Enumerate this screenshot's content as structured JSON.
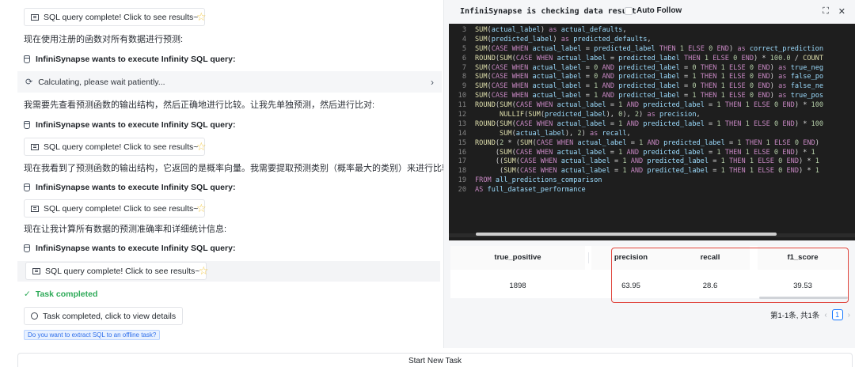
{
  "chat": {
    "chip_label": "SQL query complete! Click to see results~",
    "exec_label": "InfiniSynapse wants to execute Infinity SQL query:",
    "msg1": "现在使用注册的函数对所有数据进行预测:",
    "calculating": "Calculating, please wait patiently...",
    "msg2": "我需要先查看预测函数的输出结构，然后正确地进行比较。让我先单独预测，然后进行比对:",
    "msg3": "现在我看到了预测函数的输出结构，它返回的是概率向量。我需要提取预测类别（概率最大的类别）来进行比较:",
    "msg4": "现在让我计算所有数据的预测准确率和详细统计信息:",
    "task_completed": "Task completed",
    "view_details": "Task completed, click to view details",
    "extract_prompt": "Do you want to extract SQL to an offline task?",
    "new_task": "Start New Task"
  },
  "panel": {
    "title": "InfiniSynapse is checking data result",
    "auto_follow": "Auto Follow",
    "code_lines": [
      {
        "n": "3",
        "html": "<span class='fn'>SUM</span>(<span class='id'>actual_label</span>) <span class='kw'>as</span> <span class='id'>actual_defaults</span>,"
      },
      {
        "n": "4",
        "html": "<span class='fn'>SUM</span>(<span class='id'>predicted_label</span>) <span class='kw'>as</span> <span class='id'>predicted_defaults</span>,"
      },
      {
        "n": "5",
        "html": "<span class='fn'>SUM</span>(<span class='kw'>CASE WHEN</span> <span class='id'>actual_label</span> = <span class='id'>predicted_label</span> <span class='kw'>THEN</span> <span class='num'>1</span> <span class='kw'>ELSE</span> <span class='num'>0</span> <span class='kw'>END</span>) <span class='kw'>as</span> <span class='id'>correct_prediction</span>"
      },
      {
        "n": "6",
        "html": "<span class='fn'>ROUND</span>(<span class='fn'>SUM</span>(<span class='kw'>CASE WHEN</span> <span class='id'>actual_label</span> = <span class='id'>predicted_label</span> <span class='kw'>THEN</span> <span class='num'>1</span> <span class='kw'>ELSE</span> <span class='num'>0</span> <span class='kw'>END</span>) * <span class='num'>100.0</span> / <span class='fn'>COUNT</span>"
      },
      {
        "n": "7",
        "html": "<span class='fn'>SUM</span>(<span class='kw'>CASE WHEN</span> <span class='id'>actual_label</span> = <span class='num'>0</span> <span class='kw'>AND</span> <span class='id'>predicted_label</span> = <span class='num'>0</span> <span class='kw'>THEN</span> <span class='num'>1</span> <span class='kw'>ELSE</span> <span class='num'>0</span> <span class='kw'>END</span>) <span class='kw'>as</span> <span class='id'>true_neg</span>"
      },
      {
        "n": "8",
        "html": "<span class='fn'>SUM</span>(<span class='kw'>CASE WHEN</span> <span class='id'>actual_label</span> = <span class='num'>0</span> <span class='kw'>AND</span> <span class='id'>predicted_label</span> = <span class='num'>1</span> <span class='kw'>THEN</span> <span class='num'>1</span> <span class='kw'>ELSE</span> <span class='num'>0</span> <span class='kw'>END</span>) <span class='kw'>as</span> <span class='id'>false_po</span>"
      },
      {
        "n": "9",
        "html": "<span class='fn'>SUM</span>(<span class='kw'>CASE WHEN</span> <span class='id'>actual_label</span> = <span class='num'>1</span> <span class='kw'>AND</span> <span class='id'>predicted_label</span> = <span class='num'>0</span> <span class='kw'>THEN</span> <span class='num'>1</span> <span class='kw'>ELSE</span> <span class='num'>0</span> <span class='kw'>END</span>) <span class='kw'>as</span> <span class='id'>false_ne</span>"
      },
      {
        "n": "10",
        "html": "<span class='fn'>SUM</span>(<span class='kw'>CASE WHEN</span> <span class='id'>actual_label</span> = <span class='num'>1</span> <span class='kw'>AND</span> <span class='id'>predicted_label</span> = <span class='num'>1</span> <span class='kw'>THEN</span> <span class='num'>1</span> <span class='kw'>ELSE</span> <span class='num'>0</span> <span class='kw'>END</span>) <span class='kw'>as</span> <span class='id'>true_pos</span>"
      },
      {
        "n": "11",
        "html": "<span class='fn'>ROUND</span>(<span class='fn'>SUM</span>(<span class='kw'>CASE WHEN</span> <span class='id'>actual_label</span> = <span class='num'>1</span> <span class='kw'>AND</span> <span class='id'>predicted_label</span> = <span class='num'>1</span> <span class='kw'>THEN</span> <span class='num'>1</span> <span class='kw'>ELSE</span> <span class='num'>0</span> <span class='kw'>END</span>) * <span class='num'>100</span>"
      },
      {
        "n": "12",
        "html": "      <span class='fn'>NULLIF</span>(<span class='fn'>SUM</span>(<span class='id'>predicted_label</span>), <span class='num'>0</span>), <span class='num'>2</span>) <span class='kw'>as</span> <span class='id'>precision</span>,"
      },
      {
        "n": "13",
        "html": "<span class='fn'>ROUND</span>(<span class='fn'>SUM</span>(<span class='kw'>CASE WHEN</span> <span class='id'>actual_label</span> = <span class='num'>1</span> <span class='kw'>AND</span> <span class='id'>predicted_label</span> = <span class='num'>1</span> <span class='kw'>THEN</span> <span class='num'>1</span> <span class='kw'>ELSE</span> <span class='num'>0</span> <span class='kw'>END</span>) * <span class='num'>100</span>"
      },
      {
        "n": "14",
        "html": "      <span class='fn'>SUM</span>(<span class='id'>actual_label</span>), <span class='num'>2</span>) <span class='kw'>as</span> <span class='id'>recall</span>,"
      },
      {
        "n": "15",
        "html": "<span class='fn'>ROUND</span>(<span class='num'>2</span> * (<span class='fn'>SUM</span>(<span class='kw'>CASE WHEN</span> <span class='id'>actual_label</span> = <span class='num'>1</span> <span class='kw'>AND</span> <span class='id'>predicted_label</span> = <span class='num'>1</span> <span class='kw'>THEN</span> <span class='num'>1</span> <span class='kw'>ELSE</span> <span class='num'>0</span> <span class='kw'>END</span>)"
      },
      {
        "n": "16",
        "html": "     (<span class='fn'>SUM</span>(<span class='kw'>CASE WHEN</span> <span class='id'>actual_label</span> = <span class='num'>1</span> <span class='kw'>AND</span> <span class='id'>predicted_label</span> = <span class='num'>1</span> <span class='kw'>THEN</span> <span class='num'>1</span> <span class='kw'>ELSE</span> <span class='num'>0</span> <span class='kw'>END</span>) * <span class='num'>1</span>"
      },
      {
        "n": "17",
        "html": "     ((<span class='fn'>SUM</span>(<span class='kw'>CASE WHEN</span> <span class='id'>actual_label</span> = <span class='num'>1</span> <span class='kw'>AND</span> <span class='id'>predicted_label</span> = <span class='num'>1</span> <span class='kw'>THEN</span> <span class='num'>1</span> <span class='kw'>ELSE</span> <span class='num'>0</span> <span class='kw'>END</span>) * <span class='num'>1</span>"
      },
      {
        "n": "18",
        "html": "      (<span class='fn'>SUM</span>(<span class='kw'>CASE WHEN</span> <span class='id'>actual_label</span> = <span class='num'>1</span> <span class='kw'>AND</span> <span class='id'>predicted_label</span> = <span class='num'>1</span> <span class='kw'>THEN</span> <span class='num'>1</span> <span class='kw'>ELSE</span> <span class='num'>0</span> <span class='kw'>END</span>) * <span class='num'>1</span>"
      },
      {
        "n": "19",
        "html": "<span class='kw'>FROM</span> <span class='id'>all_predictions_comparison</span>"
      },
      {
        "n": "20",
        "html": "<span class='kw'>AS</span> <span class='id'>full_dataset_performance</span>"
      }
    ],
    "table": {
      "headers": [
        "true_positive",
        "precision",
        "recall",
        "f1_score"
      ],
      "row": [
        "1898",
        "63.95",
        "28.6",
        "39.53"
      ]
    },
    "pagination": {
      "summary": "第1-1条, 共1条",
      "page": "1"
    }
  }
}
